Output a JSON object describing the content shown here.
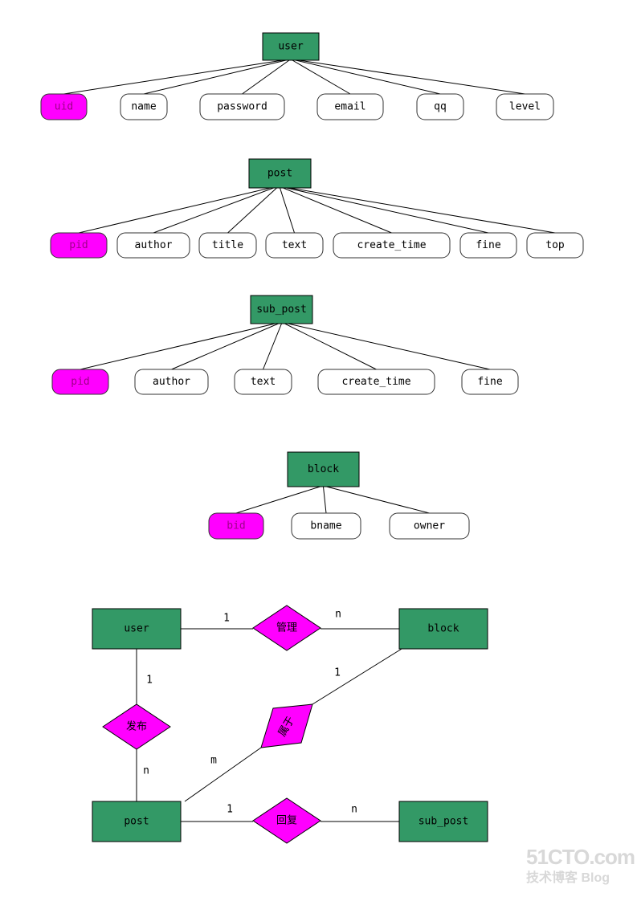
{
  "colors": {
    "entity": "#339966",
    "key": "#ff00ff",
    "line": "#000000"
  },
  "entities": [
    {
      "name": "user",
      "attributes": [
        "uid",
        "name",
        "password",
        "email",
        "qq",
        "level"
      ],
      "key": "uid"
    },
    {
      "name": "post",
      "attributes": [
        "pid",
        "author",
        "title",
        "text",
        "create_time",
        "fine",
        "top"
      ],
      "key": "pid"
    },
    {
      "name": "sub_post",
      "attributes": [
        "pid",
        "author",
        "text",
        "create_time",
        "fine"
      ],
      "key": "pid"
    },
    {
      "name": "block",
      "attributes": [
        "bid",
        "bname",
        "owner"
      ],
      "key": "bid"
    }
  ],
  "er": {
    "entities": [
      "user",
      "block",
      "post",
      "sub_post"
    ],
    "relationships": [
      "管理",
      "发布",
      "属于",
      "回复"
    ],
    "cardinalities": [
      "1",
      "n",
      "1",
      "n",
      "1",
      "m",
      "1",
      "n"
    ]
  },
  "watermark": {
    "line1": "51CTO.com",
    "line2": "技术博客 Blog"
  }
}
